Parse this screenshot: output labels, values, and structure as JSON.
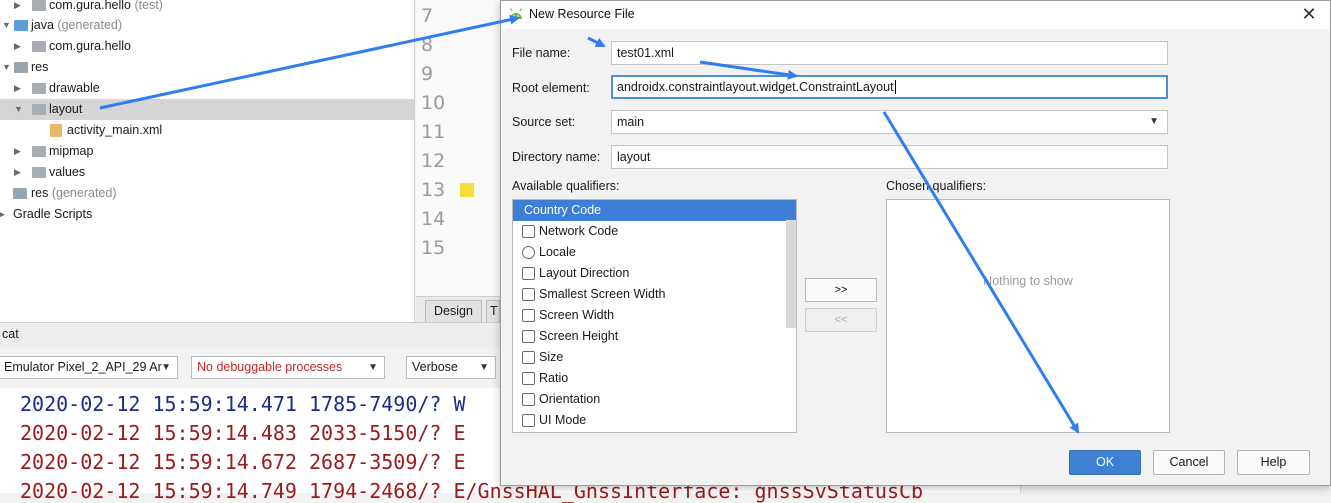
{
  "project_tree": {
    "items": [
      {
        "label": "com.gura.hello",
        "suffix": "(test)"
      },
      {
        "label": "java",
        "suffix": "(generated)"
      },
      {
        "label": "com.gura.hello",
        "suffix": ""
      },
      {
        "label": "res",
        "suffix": ""
      },
      {
        "label": "drawable",
        "suffix": ""
      },
      {
        "label": "layout",
        "suffix": ""
      },
      {
        "label": "activity_main.xml",
        "suffix": ""
      },
      {
        "label": "mipmap",
        "suffix": ""
      },
      {
        "label": "values",
        "suffix": ""
      },
      {
        "label": "res",
        "suffix": "(generated)"
      },
      {
        "label": "Gradle Scripts",
        "suffix": ""
      }
    ]
  },
  "editor": {
    "line_numbers": [
      "7",
      "8",
      "9",
      "10",
      "11",
      "12",
      "13",
      "14",
      "15"
    ],
    "tabs": {
      "design": "Design",
      "text": "T"
    }
  },
  "logcat": {
    "title": "cat",
    "device": "Emulator Pixel_2_API_29 Ar",
    "process": "No debuggable processes",
    "level": "Verbose",
    "lines": [
      "2020-02-12 15:59:14.471 1785-7490/? W",
      "2020-02-12 15:59:14.483 2033-5150/? E",
      "2020-02-12 15:59:14.672 2687-3509/? E",
      "2020-02-12 15:59:14.749 1794-2468/? E/GnssHAL_GnssInterface: gnssSvStatusCb"
    ],
    "process_color": "#c62828"
  },
  "dialog": {
    "title": "New Resource File",
    "close": "✕",
    "fields": {
      "file_name_label": "File name:",
      "file_name_value": "test01.xml",
      "root_element_label": "Root element:",
      "root_element_value": "androidx.constraintlayout.widget.ConstraintLayout",
      "source_set_label": "Source set:",
      "source_set_value": "main",
      "directory_name_label": "Directory name:",
      "directory_name_value": "layout"
    },
    "available_label": "Available qualifiers:",
    "chosen_label": "Chosen qualifiers:",
    "qualifiers": [
      {
        "label": "Country Code",
        "icon": "country-code-icon"
      },
      {
        "label": "Network Code",
        "icon": "network-code-icon"
      },
      {
        "label": "Locale",
        "icon": "globe-icon"
      },
      {
        "label": "Layout Direction",
        "icon": "layout-direction-icon"
      },
      {
        "label": "Smallest Screen Width",
        "icon": "smallest-width-icon"
      },
      {
        "label": "Screen Width",
        "icon": "screen-width-icon"
      },
      {
        "label": "Screen Height",
        "icon": "screen-height-icon"
      },
      {
        "label": "Size",
        "icon": "size-icon"
      },
      {
        "label": "Ratio",
        "icon": "ratio-icon"
      },
      {
        "label": "Orientation",
        "icon": "orientation-icon"
      },
      {
        "label": "UI Mode",
        "icon": "ui-mode-icon"
      }
    ],
    "add_button": ">>",
    "remove_button": "<<",
    "empty_text": "Nothing to show",
    "ok": "OK",
    "cancel": "Cancel",
    "help": "Help",
    "accent": "#3d80d4",
    "annotation_arrow_color": "#2f7df0"
  }
}
